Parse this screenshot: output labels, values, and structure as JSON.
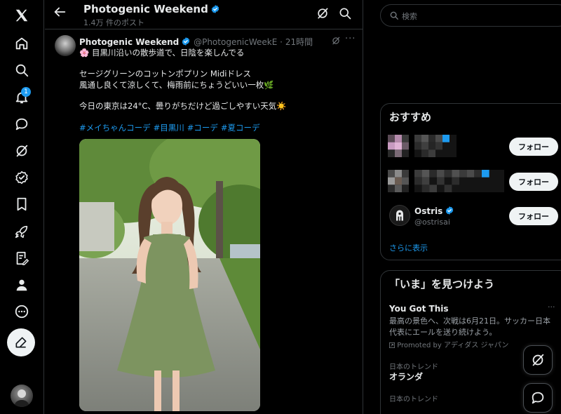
{
  "nav": {
    "notification_count": "1",
    "icons": [
      "x-logo-icon",
      "home-icon",
      "explore-icon",
      "notifications-icon",
      "messages-icon",
      "grok-icon",
      "premium-icon",
      "bookmarks-icon",
      "jobs-icon",
      "lists-icon",
      "profile-icon",
      "more-icon"
    ]
  },
  "header": {
    "name": "Photogenic Weekend",
    "post_count": "1.4万 件のポスト"
  },
  "tweet": {
    "name": "Photogenic Weekend",
    "handle": "@PhotogenicWeekE",
    "separator": "·",
    "time": "21時間",
    "line1": "🌸 目黒川沿いの散歩道で、日陰を楽しんでる",
    "line2": "セージグリーンのコットンポプリン Midiドレス",
    "line3": "風通し良くて涼しくて、梅雨前にちょうどいい一枚🌿",
    "line4": "今日の東京は24°C、曇りがちだけど過ごしやすい天気☀️",
    "hashtags": [
      "#メイちゃんコーデ",
      "#目黒川",
      "#コーデ",
      "#夏コーデ"
    ]
  },
  "search": {
    "placeholder": "検索"
  },
  "who_to_follow": {
    "title": "おすすめ",
    "follow_label": "フォロー",
    "ostris_name": "Ostris",
    "ostris_handle": "@ostrisai",
    "show_more": "さらに表示"
  },
  "trends": {
    "title": "「いま」を見つけよう",
    "promo_title": "You Got This",
    "promo_more": "···",
    "promo_line1": "最高の景色へ、次戦は6月21日。サッカー日本",
    "promo_line2": "代表にエールを送り続けよう。",
    "promoted_by": "Promoted by アディダス ジャパン",
    "trend1_label": "日本のトレンド",
    "trend1_name": "オランダ",
    "trend2_label": "日本のトレンド"
  },
  "colors": {
    "accent": "#1d9bf0",
    "background": "#000000",
    "border": "#2f3336",
    "muted": "#71767b",
    "dress": "#7d9460"
  }
}
